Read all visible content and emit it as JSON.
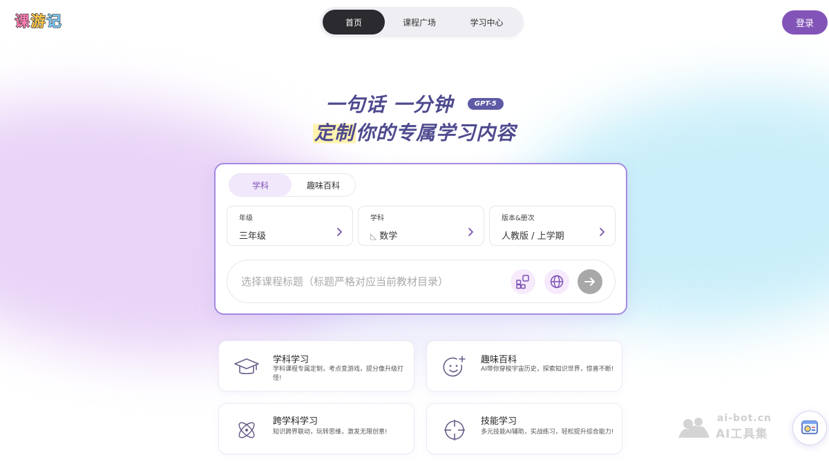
{
  "logo": {
    "chars": [
      "课",
      "游",
      "记"
    ]
  },
  "nav": {
    "items": [
      {
        "label": "首页",
        "active": true
      },
      {
        "label": "课程广场",
        "active": false
      },
      {
        "label": "学习中心",
        "active": false
      }
    ]
  },
  "header": {
    "login_label": "登录"
  },
  "hero": {
    "line1": "一句话 一分钟",
    "badge": "GPT-5",
    "line2_highlight": "定制",
    "line2_rest": "你的专属学习内容"
  },
  "card": {
    "tabs": [
      {
        "label": "学科",
        "active": true
      },
      {
        "label": "趣味百科",
        "active": false
      }
    ],
    "selectors": [
      {
        "label": "年级",
        "value": "三年级"
      },
      {
        "label": "学科",
        "value": "数学",
        "icon": "triangle-ruler-icon"
      },
      {
        "label": "版本&册次",
        "value": "人教版 / 上学期"
      }
    ],
    "prompt": {
      "placeholder": "选择课程标题（标题严格对应当前教材目录）",
      "value": ""
    }
  },
  "features": [
    {
      "title": "学科学习",
      "desc": "学科课程专属定制，考点变游戏，提分像升级打怪!",
      "icon": "graduation-cap-icon"
    },
    {
      "title": "趣味百科",
      "desc": "AI带你穿梭宇宙历史，探索知识世界，惊喜不断!",
      "icon": "smiley-plus-icon"
    },
    {
      "title": "跨学科学习",
      "desc": "知识跨界联动，玩转思维，激发无限创意!",
      "icon": "atom-icon"
    },
    {
      "title": "技能学习",
      "desc": "多元技能AI辅助，实战练习，轻松提升综合能力!",
      "icon": "crosshair-icon"
    }
  ],
  "watermark": {
    "url": "ai-bot.cn",
    "text": "AI工具集"
  },
  "colors": {
    "accent": "#8354b8",
    "hero_text": "#4e4a8e",
    "card_border": "#a489e0",
    "badge": "#5e5aa6"
  }
}
